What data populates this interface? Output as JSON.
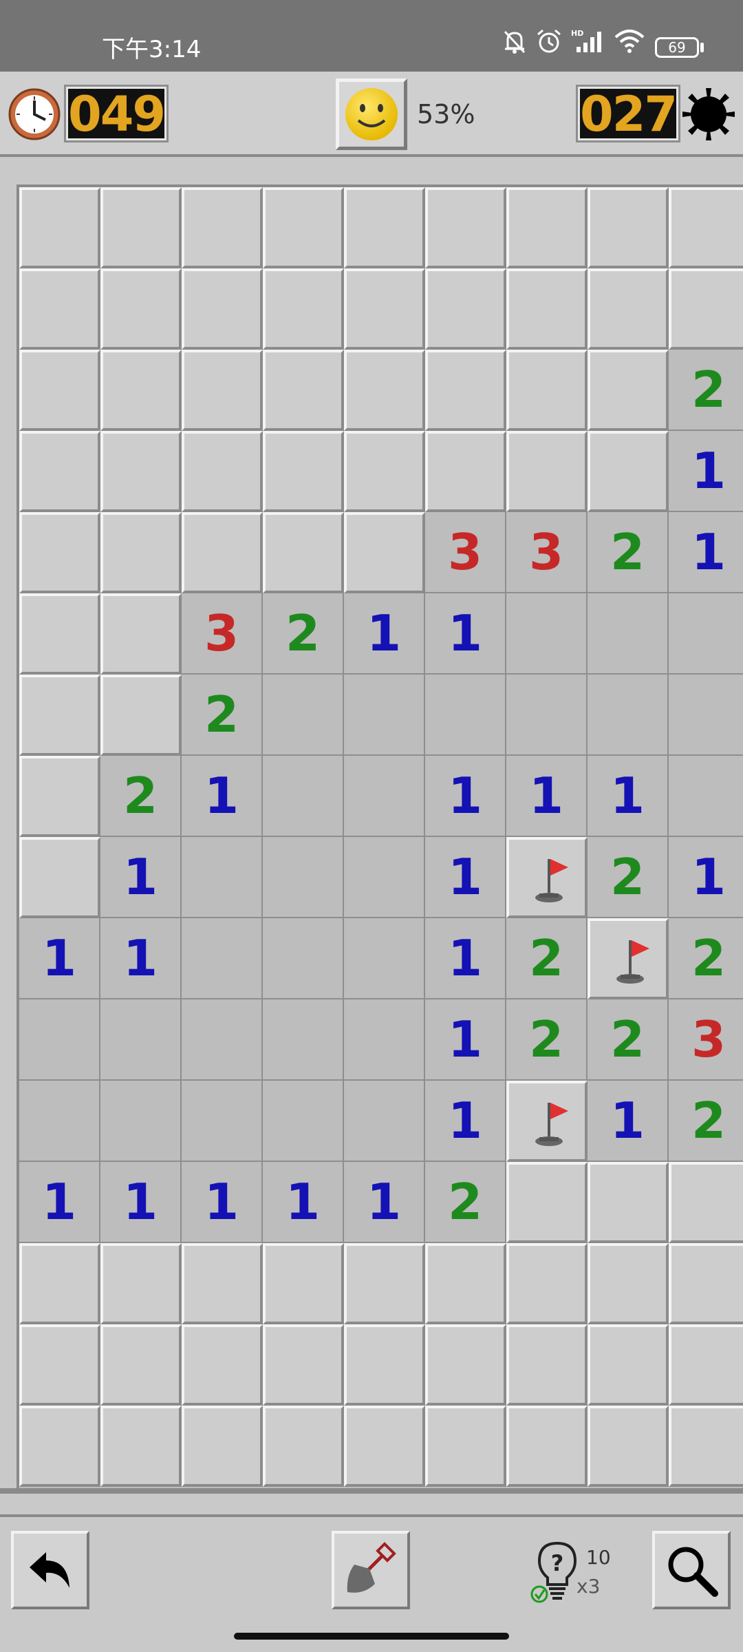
{
  "status": {
    "time": "下午3:14",
    "battery": "69"
  },
  "header": {
    "timer": "049",
    "mines_left": "027",
    "progress": "53%"
  },
  "hints": {
    "count": "10",
    "multiplier": "x3"
  },
  "board": {
    "cols": 9,
    "rows": [
      "CCCCCCCCC",
      "CCCCCCCCC",
      "CCCCCCCC2",
      "CCCCCCCC1",
      "CCCCC3321",
      "CC3211...",
      "CC2......",
      "C21..111.",
      "C1...1F21",
      "11...12F2",
      ".....1223",
      ".....1F12",
      "111112CCC",
      "CCCCCCCCC",
      "CCCCCCCCC",
      "CCCCCCCCC"
    ]
  },
  "colors": {
    "one": "#1412b4",
    "two": "#1e8a1e",
    "three": "#c62828",
    "lcd_digits": "#e3a420"
  }
}
